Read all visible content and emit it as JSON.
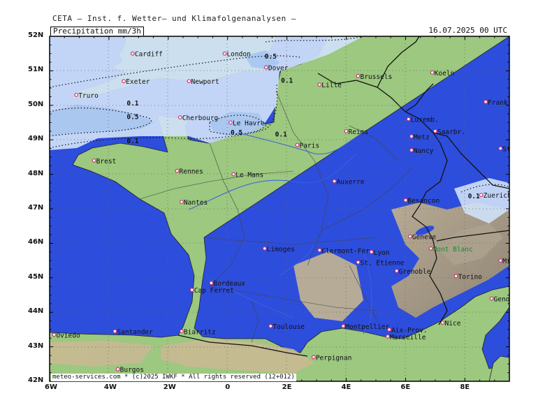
{
  "header": {
    "title": "CETA – Inst. f. Wetter– und Klimafolgenanalysen –"
  },
  "panel": {
    "variable": "Precipitation  mm/3h",
    "date": "16.07.2025 00 UTC"
  },
  "footer": {
    "credit": "meteo-services.com * (c)2025 IWKF * All rights reserved (12+012)"
  },
  "axes": {
    "lat": [
      "52N",
      "51N",
      "50N",
      "49N",
      "48N",
      "47N",
      "46N",
      "45N",
      "44N",
      "43N",
      "42N"
    ],
    "lon": [
      "6W",
      "4W",
      "2W",
      "0",
      "2E",
      "4E",
      "6E",
      "8E"
    ]
  },
  "cities": [
    {
      "name": "Cardiff",
      "lon": -3.2,
      "lat": 51.5
    },
    {
      "name": "London",
      "lon": -0.1,
      "lat": 51.5
    },
    {
      "name": "Dover",
      "lon": 1.3,
      "lat": 51.1
    },
    {
      "name": "Exeter",
      "lon": -3.5,
      "lat": 50.7
    },
    {
      "name": "Newport",
      "lon": -1.3,
      "lat": 50.7
    },
    {
      "name": "Truro",
      "lon": -5.1,
      "lat": 50.3
    },
    {
      "name": "Cherbourg",
      "lon": -1.6,
      "lat": 49.65
    },
    {
      "name": "Le Havre",
      "lon": 0.1,
      "lat": 49.5
    },
    {
      "name": "Lille",
      "lon": 3.1,
      "lat": 50.6
    },
    {
      "name": "Brussels",
      "lon": 4.4,
      "lat": 50.85
    },
    {
      "name": "Koeln",
      "lon": 6.9,
      "lat": 50.95
    },
    {
      "name": "Frankfurt",
      "lon": 8.7,
      "lat": 50.1
    },
    {
      "name": "Luxemb.",
      "lon": 6.1,
      "lat": 49.6
    },
    {
      "name": "Saarbr.",
      "lon": 7.0,
      "lat": 49.25
    },
    {
      "name": "Metz",
      "lon": 6.2,
      "lat": 49.1
    },
    {
      "name": "Reims",
      "lon": 4.0,
      "lat": 49.25
    },
    {
      "name": "Paris",
      "lon": 2.35,
      "lat": 48.85
    },
    {
      "name": "Nancy",
      "lon": 6.2,
      "lat": 48.7
    },
    {
      "name": "Stuttgart",
      "lon": 9.2,
      "lat": 48.75
    },
    {
      "name": "Brest",
      "lon": -4.5,
      "lat": 48.4
    },
    {
      "name": "Rennes",
      "lon": -1.7,
      "lat": 48.1
    },
    {
      "name": "Le Mans",
      "lon": 0.2,
      "lat": 48.0
    },
    {
      "name": "Auxerre",
      "lon": 3.6,
      "lat": 47.8
    },
    {
      "name": "Nantes",
      "lon": -1.55,
      "lat": 47.2
    },
    {
      "name": "Besancon",
      "lon": 6.0,
      "lat": 47.25
    },
    {
      "name": "Zuerich",
      "lon": 8.55,
      "lat": 47.4
    },
    {
      "name": "Geneve",
      "lon": 6.15,
      "lat": 46.2
    },
    {
      "name": "Mont Blanc",
      "lon": 6.85,
      "lat": 45.85
    },
    {
      "name": "Limoges",
      "lon": 1.25,
      "lat": 45.85
    },
    {
      "name": "Clermont-Fer",
      "lon": 3.1,
      "lat": 45.8
    },
    {
      "name": "Lyon",
      "lon": 4.85,
      "lat": 45.75
    },
    {
      "name": "St. Etienne",
      "lon": 4.4,
      "lat": 45.45
    },
    {
      "name": "Grenoble",
      "lon": 5.7,
      "lat": 45.2
    },
    {
      "name": "Milano",
      "lon": 9.2,
      "lat": 45.5
    },
    {
      "name": "Torino",
      "lon": 7.7,
      "lat": 45.05
    },
    {
      "name": "Bordeaux",
      "lon": -0.55,
      "lat": 44.85
    },
    {
      "name": "Cap Ferret",
      "lon": -1.2,
      "lat": 44.65
    },
    {
      "name": "Genova",
      "lon": 8.9,
      "lat": 44.4
    },
    {
      "name": "Nice",
      "lon": 7.25,
      "lat": 43.7
    },
    {
      "name": "Montpellier",
      "lon": 3.9,
      "lat": 43.6
    },
    {
      "name": "Toulouse",
      "lon": 1.45,
      "lat": 43.6
    },
    {
      "name": "Aix-Prov.",
      "lon": 5.45,
      "lat": 43.5
    },
    {
      "name": "Marseille",
      "lon": 5.4,
      "lat": 43.3
    },
    {
      "name": "Biarritz",
      "lon": -1.55,
      "lat": 43.45
    },
    {
      "name": "Oviedo",
      "lon": -5.85,
      "lat": 43.35
    },
    {
      "name": "Santander",
      "lon": -3.8,
      "lat": 43.45
    },
    {
      "name": "Perpignan",
      "lon": 2.9,
      "lat": 42.7
    },
    {
      "name": "Burgos",
      "lon": -3.7,
      "lat": 42.35
    }
  ],
  "contour_labels": [
    {
      "text": "0.5",
      "lon": 1.25,
      "lat": 51.35
    },
    {
      "text": "0.1",
      "lon": 1.8,
      "lat": 50.65
    },
    {
      "text": "0.1",
      "lon": -3.4,
      "lat": 50.0
    },
    {
      "text": "0.5",
      "lon": -3.4,
      "lat": 49.6
    },
    {
      "text": "0.5",
      "lon": 0.1,
      "lat": 49.15
    },
    {
      "text": "0.1",
      "lon": 1.6,
      "lat": 49.1
    },
    {
      "text": "0.1",
      "lon": -3.4,
      "lat": 48.9
    },
    {
      "text": "0.1",
      "lon": 8.1,
      "lat": 47.3
    }
  ],
  "colors": {
    "sea": "#2d4ddc",
    "land": "#9cc87f",
    "precip_light": "#cfe1f7",
    "precip_mid": "#a9c6ef",
    "city": "#d03070",
    "border": "#111111"
  }
}
